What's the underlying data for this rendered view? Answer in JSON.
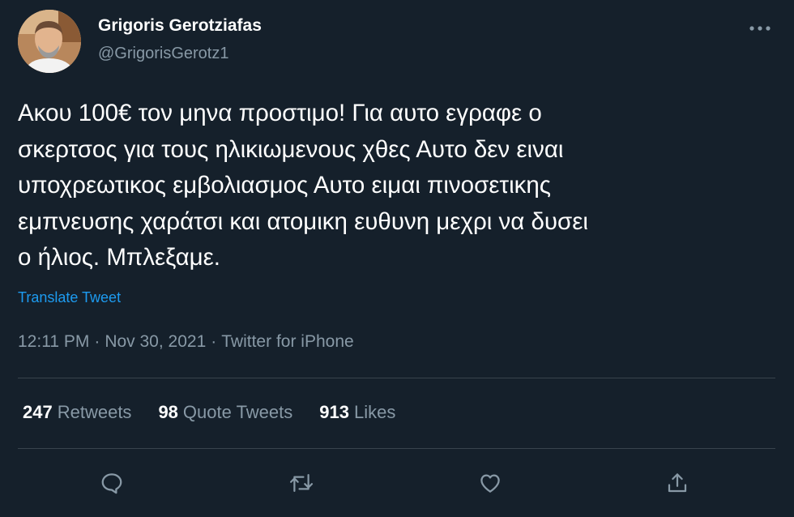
{
  "author": {
    "display_name": "Grigoris Gerotziafas",
    "handle": "@GrigorisGerotz1",
    "avatar_icon": "profile-photo"
  },
  "tweet": {
    "text": "Ακου 100€ τον μηνα προστιμο! Για αυτο εγραφε ο\nσκερτσος για τους ηλικιωμενους χθες Αυτο δεν ειναι\nυποχρεωτικος εμβολιασμος Αυτο ειμαι πινοσετικης\nεμπνευσης χαράτσι και ατομικη ευθυνη μεχρι να δυσει\nο ήλιος. Μπλεξαμε.",
    "translate_label": "Translate Tweet",
    "time": "12:11 PM",
    "date": "Nov 30, 2021",
    "source": "Twitter for iPhone",
    "separator": "·"
  },
  "stats": {
    "retweets": {
      "count": "247",
      "label": "Retweets"
    },
    "quotes": {
      "count": "98",
      "label": "Quote Tweets"
    },
    "likes": {
      "count": "913",
      "label": "Likes"
    }
  },
  "actions": [
    "reply-icon",
    "retweet-icon",
    "like-icon",
    "share-icon"
  ],
  "colors": {
    "background": "#15202b",
    "text": "#ffffff",
    "muted": "#8899a6",
    "link": "#1d9bf0",
    "divider": "#38444d"
  }
}
